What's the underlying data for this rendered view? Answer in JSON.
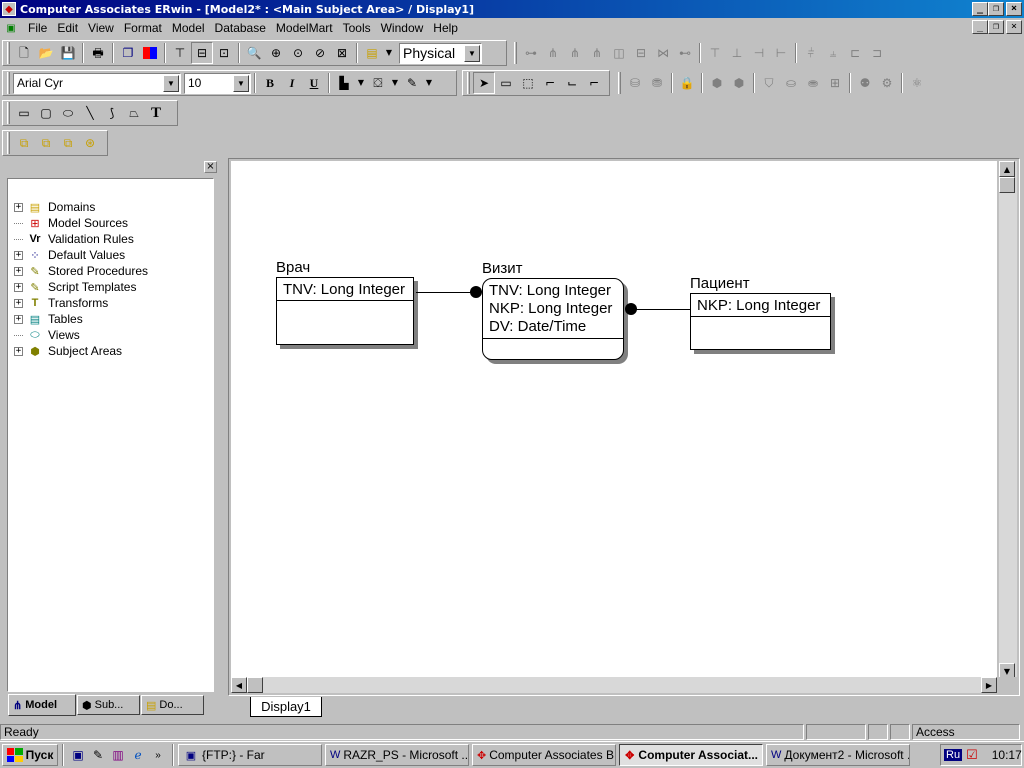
{
  "window": {
    "title": "Computer Associates ERwin - [Model2* : <Main Subject Area> / Display1]",
    "minimize": "_",
    "restore": "❐",
    "close": "×"
  },
  "menu": [
    "File",
    "Edit",
    "View",
    "Format",
    "Model",
    "Database",
    "ModelMart",
    "Tools",
    "Window",
    "Help"
  ],
  "toolbar": {
    "notation_select": "Physical",
    "font_name": "Arial Cyr",
    "font_size": "10",
    "bold": "B",
    "italic": "I",
    "underline": "U",
    "text_tool": "T"
  },
  "model_explorer": {
    "close": "×",
    "items": [
      {
        "label": "Domains",
        "expandable": true,
        "icon": "domains-icon"
      },
      {
        "label": "Model Sources",
        "expandable": false,
        "icon": "model-sources-icon"
      },
      {
        "label": "Validation Rules",
        "expandable": false,
        "icon": "validation-rules-icon"
      },
      {
        "label": "Default Values",
        "expandable": true,
        "icon": "default-values-icon"
      },
      {
        "label": "Stored Procedures",
        "expandable": true,
        "icon": "stored-procedures-icon"
      },
      {
        "label": "Script Templates",
        "expandable": true,
        "icon": "script-templates-icon"
      },
      {
        "label": "Transforms",
        "expandable": true,
        "icon": "transforms-icon"
      },
      {
        "label": "Tables",
        "expandable": true,
        "icon": "tables-icon"
      },
      {
        "label": "Views",
        "expandable": false,
        "icon": "views-icon"
      },
      {
        "label": "Subject Areas",
        "expandable": true,
        "icon": "subject-areas-icon"
      }
    ],
    "tabs": [
      "Model",
      "Sub...",
      "Do..."
    ]
  },
  "diagram": {
    "entities": [
      {
        "name": "Врач",
        "keys": [
          "TNV: Long Integer"
        ],
        "attrs": [],
        "rounded": false
      },
      {
        "name": "Визит",
        "keys": [
          "TNV: Long Integer",
          "NKP: Long Integer",
          "DV: Date/Time"
        ],
        "attrs": [],
        "rounded": true
      },
      {
        "name": "Пациент",
        "keys": [
          "NKP: Long Integer"
        ],
        "attrs": [],
        "rounded": false
      }
    ],
    "relationships": [
      {
        "from": "Врач",
        "to": "Визит"
      },
      {
        "from": "Пациент",
        "to": "Визит"
      }
    ],
    "display_tab": "Display1"
  },
  "status": {
    "text": "Ready",
    "access": "Access"
  },
  "taskbar": {
    "start": "Пуск",
    "tasks": [
      {
        "label": "{FTP:} - Far",
        "active": false
      },
      {
        "label": "RAZR_PS - Microsoft ...",
        "active": false
      },
      {
        "label": "Computer Associates B...",
        "active": false
      },
      {
        "label": "Computer Associat...",
        "active": true
      },
      {
        "label": "Документ2 - Microsoft ...",
        "active": false
      }
    ],
    "lang": "Ru",
    "clock": "10:17"
  }
}
